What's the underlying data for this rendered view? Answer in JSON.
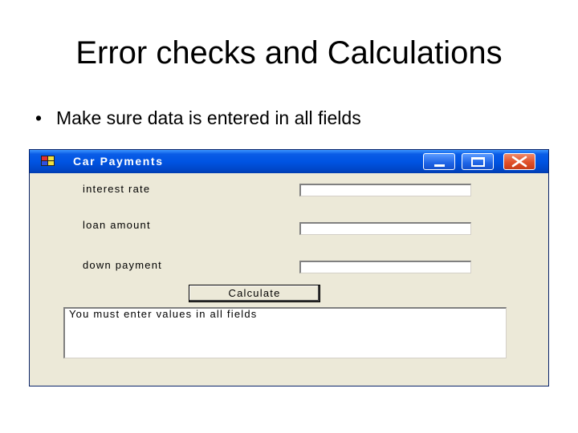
{
  "slide": {
    "title": "Error checks and Calculations",
    "bullet": "Make sure data is entered in all fields"
  },
  "window": {
    "title": "Car Payments",
    "controls": [
      "minimize-icon",
      "maximize-icon",
      "close-icon"
    ],
    "fields": [
      {
        "label": "interest rate",
        "value": ""
      },
      {
        "label": "loan amount",
        "value": ""
      },
      {
        "label": "down payment",
        "value": ""
      }
    ],
    "calculate_label": "Calculate",
    "output_text": "You must enter values in all fields"
  },
  "colors": {
    "titlebar": "#0054e3",
    "window_face": "#ece9d8",
    "close_button": "#e0502a"
  }
}
